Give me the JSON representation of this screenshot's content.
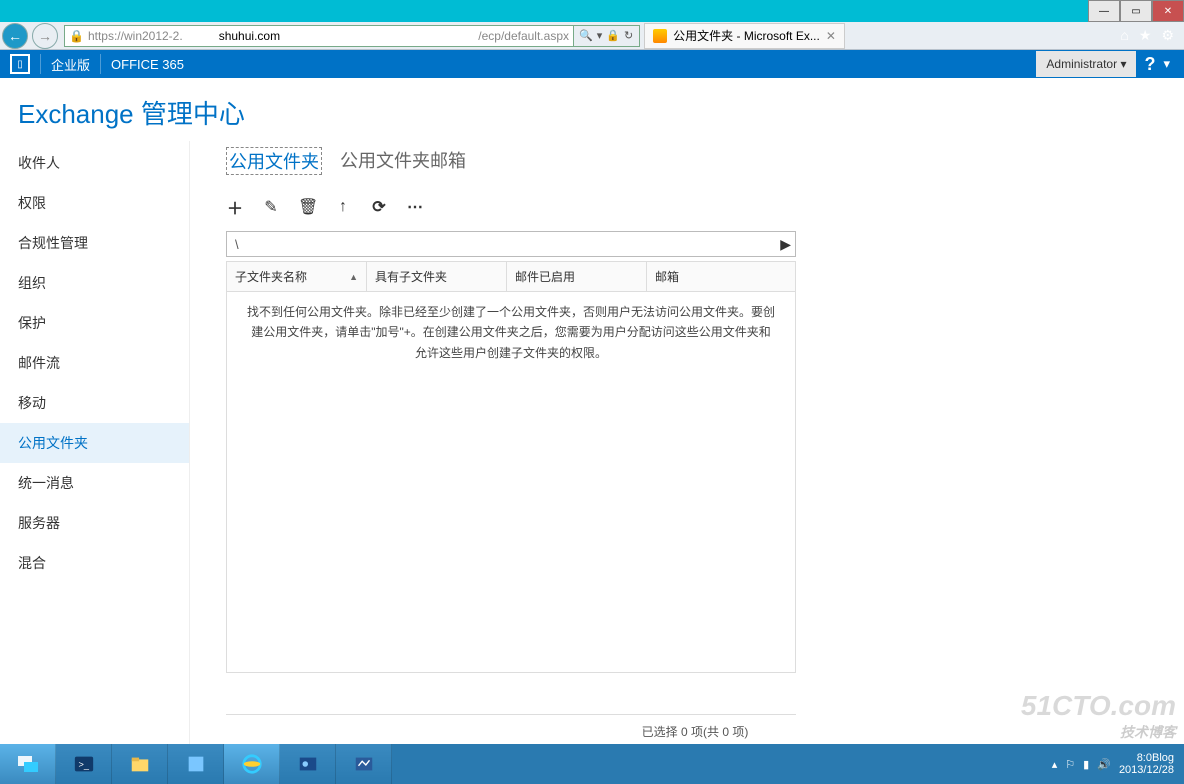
{
  "window": {
    "min": "—",
    "max": "▭",
    "close": "✕"
  },
  "ie": {
    "url_pre": "https://",
    "url_host": "win2012-2.",
    "url_domain": "shuhui.com",
    "url_path": "/ecp/default.aspx",
    "tab_title": "公用文件夹 - Microsoft Ex..."
  },
  "o365": {
    "enterprise": "企业版",
    "brand": "OFFICE 365",
    "user": "Administrator",
    "help": "?"
  },
  "page_title": "Exchange 管理中心",
  "sidebar": {
    "items": [
      {
        "label": "收件人"
      },
      {
        "label": "权限"
      },
      {
        "label": "合规性管理"
      },
      {
        "label": "组织"
      },
      {
        "label": "保护"
      },
      {
        "label": "邮件流"
      },
      {
        "label": "移动"
      },
      {
        "label": "公用文件夹"
      },
      {
        "label": "统一消息"
      },
      {
        "label": "服务器"
      },
      {
        "label": "混合"
      }
    ],
    "active_index": 7
  },
  "subtabs": {
    "items": [
      {
        "label": "公用文件夹"
      },
      {
        "label": "公用文件夹邮箱"
      }
    ],
    "active_index": 0
  },
  "toolbar": {
    "add": "＋",
    "edit": "✎",
    "delete": "🗑",
    "up": "↑",
    "refresh": "⟳",
    "more": "⋯"
  },
  "breadcrumb": {
    "path": "\\"
  },
  "grid": {
    "columns": {
      "c1": "子文件夹名称",
      "sort": "▲",
      "c2": "具有子文件夹",
      "c3": "邮件已启用",
      "c4": "邮箱"
    },
    "empty_msg": "找不到任何公用文件夹。除非已经至少创建了一个公用文件夹，否则用户无法访问公用文件夹。要创建公用文件夹，请单击\"加号\"+。在创建公用文件夹之后，您需要为用户分配访问这些公用文件夹和允许这些用户创建子文件夹的权限。"
  },
  "status": "已选择 0 项(共 0 项)",
  "taskbar": {
    "time": "8:0Blog",
    "date": "2013/12/28"
  },
  "watermark": {
    "main": "51CTO.com",
    "sub": "技术博客"
  }
}
